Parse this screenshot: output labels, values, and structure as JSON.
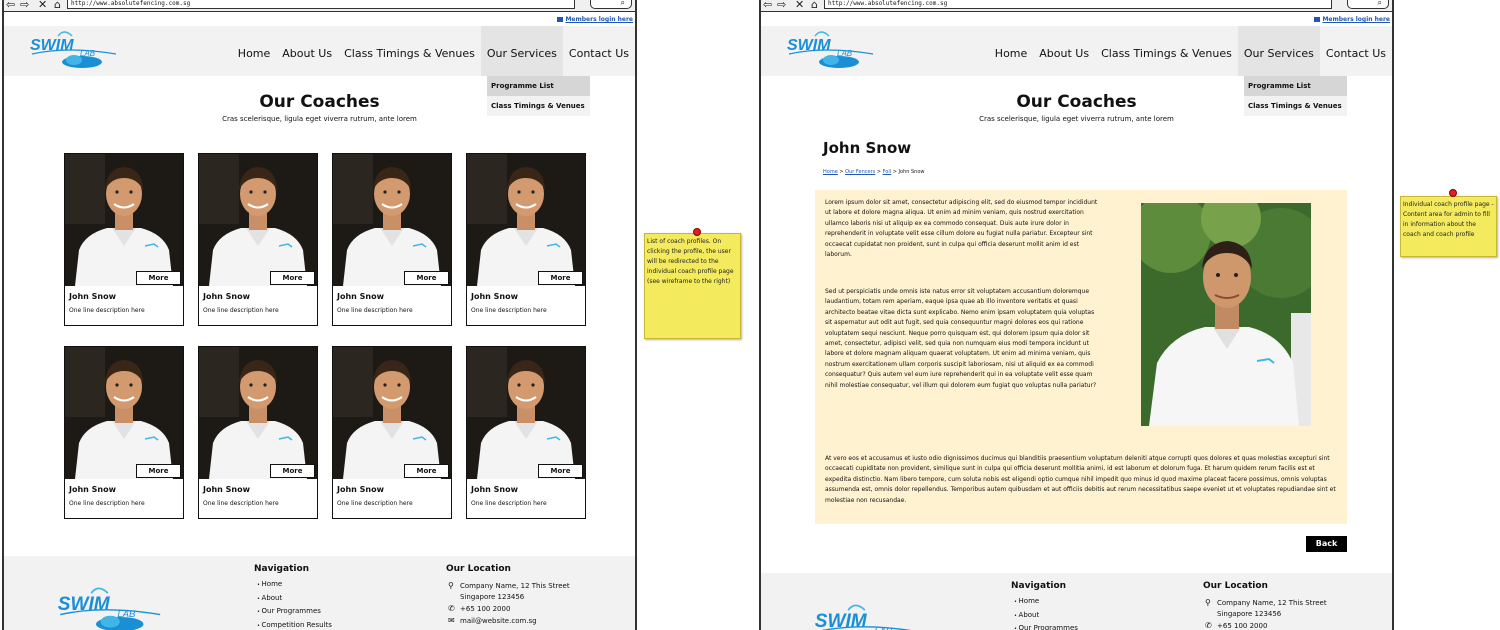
{
  "browser": {
    "back": "⇦",
    "forward": "⇨",
    "close": "✕",
    "url": "http://www.absolutefencing.com.sg"
  },
  "members_link": "Members login here",
  "logo": {
    "text": "SWIM",
    "sub": "LAB"
  },
  "nav": [
    "Home",
    "About Us",
    "Class Timings & Venues",
    "Our Services",
    "Contact Us"
  ],
  "dropdown": [
    "Programme List",
    "Class Timings & Venues"
  ],
  "page": {
    "title": "Our Coaches",
    "subtitle": "Cras scelerisque, ligula eget viverra rutrum, ante lorem"
  },
  "coaches": [
    {
      "name": "John Snow",
      "desc": "One line description here",
      "more": "More"
    },
    {
      "name": "John Snow",
      "desc": "One line description here",
      "more": "More"
    },
    {
      "name": "John Snow",
      "desc": "One line description here",
      "more": "More"
    },
    {
      "name": "John Snow",
      "desc": "One line description here",
      "more": "More"
    },
    {
      "name": "John Snow",
      "desc": "One line description here",
      "more": "More"
    },
    {
      "name": "John Snow",
      "desc": "One line description here",
      "more": "More"
    },
    {
      "name": "John Snow",
      "desc": "One line description here",
      "more": "More"
    },
    {
      "name": "John Snow",
      "desc": "One line description here",
      "more": "More"
    }
  ],
  "footer": {
    "nav_title": "Navigation",
    "nav_items": [
      "Home",
      "About",
      "Our Programmes",
      "Competition Results"
    ],
    "location_title": "Our Location",
    "address_line1": "Company Name, 12 This Street",
    "address_line2": "Singapore 123456",
    "phone": "+65 100 2000",
    "email": "mail@website.com.sg"
  },
  "notes": {
    "left": "List of coach profiles. On clicking the profile, the user will be redirected to the individual coach profile page (see wireframe to the right)",
    "right": "Individual coach profile page - Content area for admin to fill in information about the coach and coach profile"
  },
  "profile": {
    "name": "John Snow",
    "breadcrumb": [
      "Home",
      "Our Fencers",
      "Foil",
      "John Snow"
    ],
    "breadcrumb_sep": " > ",
    "bio_1": "Lorem ipsum dolor sit amet, consectetur adipiscing elit, sed do eiusmod tempor incididunt ut labore et dolore magna aliqua. Ut enim ad minim veniam, quis nostrud exercitation ullamco laboris nisi ut aliquip ex ea commodo consequat. Duis aute irure dolor in reprehenderit in voluptate velit esse cillum dolore eu fugiat nulla pariatur. Excepteur sint occaecat cupidatat non proident, sunt in culpa qui officia deserunt mollit anim id est laborum.",
    "bio_2": "Sed ut perspiciatis unde omnis iste natus error sit voluptatem accusantium doloremque laudantium, totam rem aperiam, eaque ipsa quae ab illo inventore veritatis et quasi architecto beatae vitae dicta sunt explicabo. Nemo enim ipsam voluptatem quia voluptas sit aspernatur aut odit aut fugit, sed quia consequuntur magni dolores eos qui ratione voluptatem sequi nesciunt. Neque porro quisquam est, qui dolorem ipsum quia dolor sit amet, consectetur, adipisci velit, sed quia non numquam eius modi tempora incidunt ut labore et dolore magnam aliquam quaerat voluptatem. Ut enim ad minima veniam, quis nostrum exercitationem ullam corporis suscipit laboriosam, nisi ut aliquid ex ea commodi consequatur? Quis autem vel eum iure reprehenderit qui in ea voluptate velit esse quam nihil molestiae consequatur, vel illum qui dolorem eum fugiat quo voluptas nulla pariatur?",
    "bio_3": "At vero eos et accusamus et iusto odio dignissimos ducimus qui blanditiis praesentium voluptatum deleniti atque corrupti quos dolores et quas molestias excepturi sint occaecati cupiditate non provident, similique sunt in culpa qui officia deserunt mollitia animi, id est laborum et dolorum fuga. Et harum quidem rerum facilis est et expedita distinctio. Nam libero tempore, cum soluta nobis est eligendi optio cumque nihil impedit quo minus id quod maxime placeat facere possimus, omnis voluptas assumenda est, omnis dolor repellendus. Temporibus autem quibusdam et aut officiis debitis aut rerum necessitatibus saepe eveniet ut et voluptates repudiandae sint et molestiae non recusandae.",
    "back": "Back"
  },
  "colors": {
    "link": "#1f56b8",
    "logo_blue": "#1a8fd6",
    "sticky": "#f4ea5d",
    "bio_bg": "#fff2d1"
  }
}
